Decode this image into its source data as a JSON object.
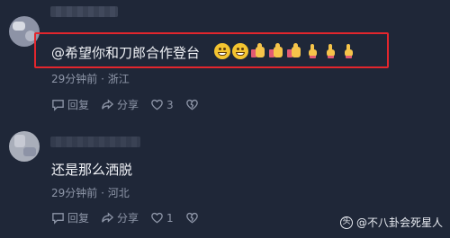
{
  "comments": [
    {
      "text": "@希望你和刀郎合作登台",
      "meta": "29分钟前 · 浙江",
      "reply_label": "回复",
      "share_label": "分享",
      "like_count": "3",
      "emojis": [
        "grin-emoji",
        "grin-emoji",
        "thumbs-up-emoji",
        "thumbs-up-emoji",
        "thumbs-up-emoji",
        "pointing-up-emoji",
        "pointing-up-emoji",
        "pointing-up-emoji"
      ]
    },
    {
      "text": "还是那么洒脱",
      "meta": "29分钟前 · 河北",
      "reply_label": "回复",
      "share_label": "分享",
      "like_count": "1"
    }
  ],
  "watermark": "@不八卦会死星人",
  "colors": {
    "background": "#1f2738",
    "highlight": "#e3262d",
    "meta_text": "#8e96a8"
  }
}
